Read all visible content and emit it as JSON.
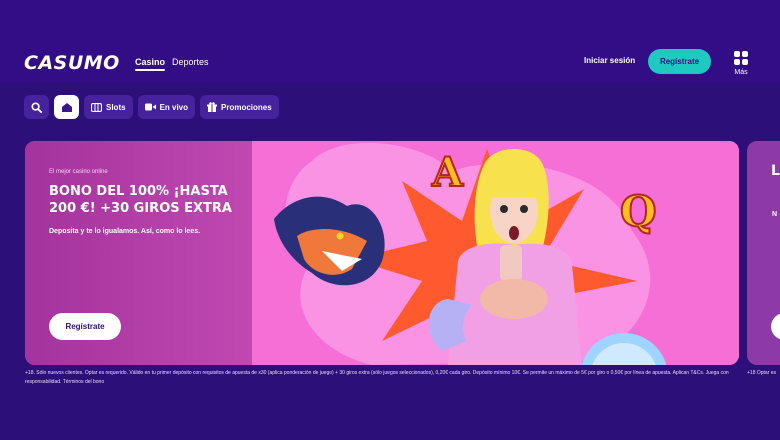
{
  "header": {
    "logo": "CASUMO",
    "nav": [
      {
        "label": "Casino",
        "active": true
      },
      {
        "label": "Deportes",
        "active": false
      }
    ],
    "login_label": "Iniciar sesión",
    "register_label": "Regístrate",
    "more_label": "Más"
  },
  "categories": [
    {
      "label": "",
      "icon": "search-icon"
    },
    {
      "label": "",
      "icon": "home-icon",
      "active": true
    },
    {
      "label": "Slots",
      "icon": "slot-machine-icon"
    },
    {
      "label": "En vivo",
      "icon": "video-camera-icon"
    },
    {
      "label": "Promociones",
      "icon": "gift-icon"
    }
  ],
  "banner": {
    "eyebrow": "El mejor casino online",
    "title": "BONO DEL 100% ¡HASTA 200 €! +30 GIROS EXTRA",
    "subtitle": "Deposita y te lo igualamos. Así, como lo lees.",
    "cta_label": "Regístrate",
    "terms": "+18. Sólo nuevos clientes. Optar es requerido. Válido en tu primer depósito con requisitos de apuesta de x30 (aplica ponderación de juego) + 30 giros extra (sólo juegos seleccionados), 0,20€ cada giro. Depósito mínimo 10€. Se permite un máximo de 5€ por giro o 0,50€ por línea de apuesta. Aplican T&Cs. Juega con responsabilidad. Términos del bono"
  },
  "next_banner": {
    "title_fragment": "L",
    "sub_fragment": "N",
    "terms_fragment": "+18 Optar es"
  },
  "colors": {
    "background": "#2d0f7a",
    "accent": "#1ecac0",
    "banner_pink": "#f56fd6"
  }
}
